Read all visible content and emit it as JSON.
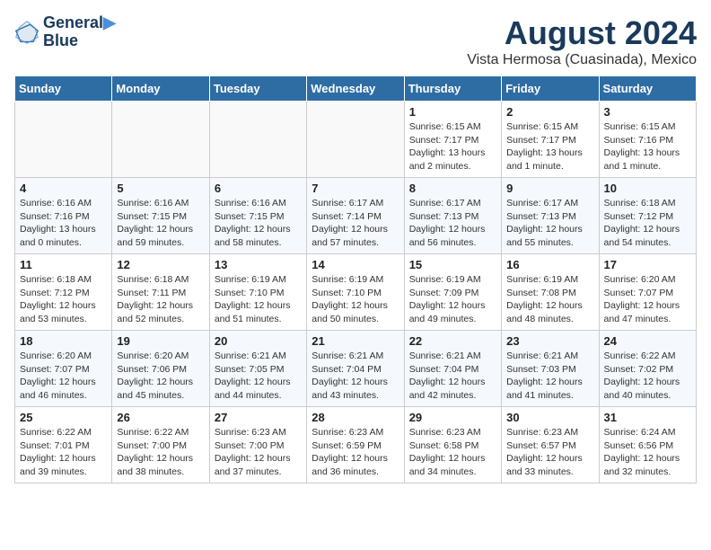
{
  "header": {
    "logo_line1": "General",
    "logo_line2": "Blue",
    "month_year": "August 2024",
    "location": "Vista Hermosa (Cuasinada), Mexico"
  },
  "days_of_week": [
    "Sunday",
    "Monday",
    "Tuesday",
    "Wednesday",
    "Thursday",
    "Friday",
    "Saturday"
  ],
  "weeks": [
    [
      {
        "day": "",
        "info": ""
      },
      {
        "day": "",
        "info": ""
      },
      {
        "day": "",
        "info": ""
      },
      {
        "day": "",
        "info": ""
      },
      {
        "day": "1",
        "info": "Sunrise: 6:15 AM\nSunset: 7:17 PM\nDaylight: 13 hours\nand 2 minutes."
      },
      {
        "day": "2",
        "info": "Sunrise: 6:15 AM\nSunset: 7:17 PM\nDaylight: 13 hours\nand 1 minute."
      },
      {
        "day": "3",
        "info": "Sunrise: 6:15 AM\nSunset: 7:16 PM\nDaylight: 13 hours\nand 1 minute."
      }
    ],
    [
      {
        "day": "4",
        "info": "Sunrise: 6:16 AM\nSunset: 7:16 PM\nDaylight: 13 hours\nand 0 minutes."
      },
      {
        "day": "5",
        "info": "Sunrise: 6:16 AM\nSunset: 7:15 PM\nDaylight: 12 hours\nand 59 minutes."
      },
      {
        "day": "6",
        "info": "Sunrise: 6:16 AM\nSunset: 7:15 PM\nDaylight: 12 hours\nand 58 minutes."
      },
      {
        "day": "7",
        "info": "Sunrise: 6:17 AM\nSunset: 7:14 PM\nDaylight: 12 hours\nand 57 minutes."
      },
      {
        "day": "8",
        "info": "Sunrise: 6:17 AM\nSunset: 7:13 PM\nDaylight: 12 hours\nand 56 minutes."
      },
      {
        "day": "9",
        "info": "Sunrise: 6:17 AM\nSunset: 7:13 PM\nDaylight: 12 hours\nand 55 minutes."
      },
      {
        "day": "10",
        "info": "Sunrise: 6:18 AM\nSunset: 7:12 PM\nDaylight: 12 hours\nand 54 minutes."
      }
    ],
    [
      {
        "day": "11",
        "info": "Sunrise: 6:18 AM\nSunset: 7:12 PM\nDaylight: 12 hours\nand 53 minutes."
      },
      {
        "day": "12",
        "info": "Sunrise: 6:18 AM\nSunset: 7:11 PM\nDaylight: 12 hours\nand 52 minutes."
      },
      {
        "day": "13",
        "info": "Sunrise: 6:19 AM\nSunset: 7:10 PM\nDaylight: 12 hours\nand 51 minutes."
      },
      {
        "day": "14",
        "info": "Sunrise: 6:19 AM\nSunset: 7:10 PM\nDaylight: 12 hours\nand 50 minutes."
      },
      {
        "day": "15",
        "info": "Sunrise: 6:19 AM\nSunset: 7:09 PM\nDaylight: 12 hours\nand 49 minutes."
      },
      {
        "day": "16",
        "info": "Sunrise: 6:19 AM\nSunset: 7:08 PM\nDaylight: 12 hours\nand 48 minutes."
      },
      {
        "day": "17",
        "info": "Sunrise: 6:20 AM\nSunset: 7:07 PM\nDaylight: 12 hours\nand 47 minutes."
      }
    ],
    [
      {
        "day": "18",
        "info": "Sunrise: 6:20 AM\nSunset: 7:07 PM\nDaylight: 12 hours\nand 46 minutes."
      },
      {
        "day": "19",
        "info": "Sunrise: 6:20 AM\nSunset: 7:06 PM\nDaylight: 12 hours\nand 45 minutes."
      },
      {
        "day": "20",
        "info": "Sunrise: 6:21 AM\nSunset: 7:05 PM\nDaylight: 12 hours\nand 44 minutes."
      },
      {
        "day": "21",
        "info": "Sunrise: 6:21 AM\nSunset: 7:04 PM\nDaylight: 12 hours\nand 43 minutes."
      },
      {
        "day": "22",
        "info": "Sunrise: 6:21 AM\nSunset: 7:04 PM\nDaylight: 12 hours\nand 42 minutes."
      },
      {
        "day": "23",
        "info": "Sunrise: 6:21 AM\nSunset: 7:03 PM\nDaylight: 12 hours\nand 41 minutes."
      },
      {
        "day": "24",
        "info": "Sunrise: 6:22 AM\nSunset: 7:02 PM\nDaylight: 12 hours\nand 40 minutes."
      }
    ],
    [
      {
        "day": "25",
        "info": "Sunrise: 6:22 AM\nSunset: 7:01 PM\nDaylight: 12 hours\nand 39 minutes."
      },
      {
        "day": "26",
        "info": "Sunrise: 6:22 AM\nSunset: 7:00 PM\nDaylight: 12 hours\nand 38 minutes."
      },
      {
        "day": "27",
        "info": "Sunrise: 6:23 AM\nSunset: 7:00 PM\nDaylight: 12 hours\nand 37 minutes."
      },
      {
        "day": "28",
        "info": "Sunrise: 6:23 AM\nSunset: 6:59 PM\nDaylight: 12 hours\nand 36 minutes."
      },
      {
        "day": "29",
        "info": "Sunrise: 6:23 AM\nSunset: 6:58 PM\nDaylight: 12 hours\nand 34 minutes."
      },
      {
        "day": "30",
        "info": "Sunrise: 6:23 AM\nSunset: 6:57 PM\nDaylight: 12 hours\nand 33 minutes."
      },
      {
        "day": "31",
        "info": "Sunrise: 6:24 AM\nSunset: 6:56 PM\nDaylight: 12 hours\nand 32 minutes."
      }
    ]
  ]
}
